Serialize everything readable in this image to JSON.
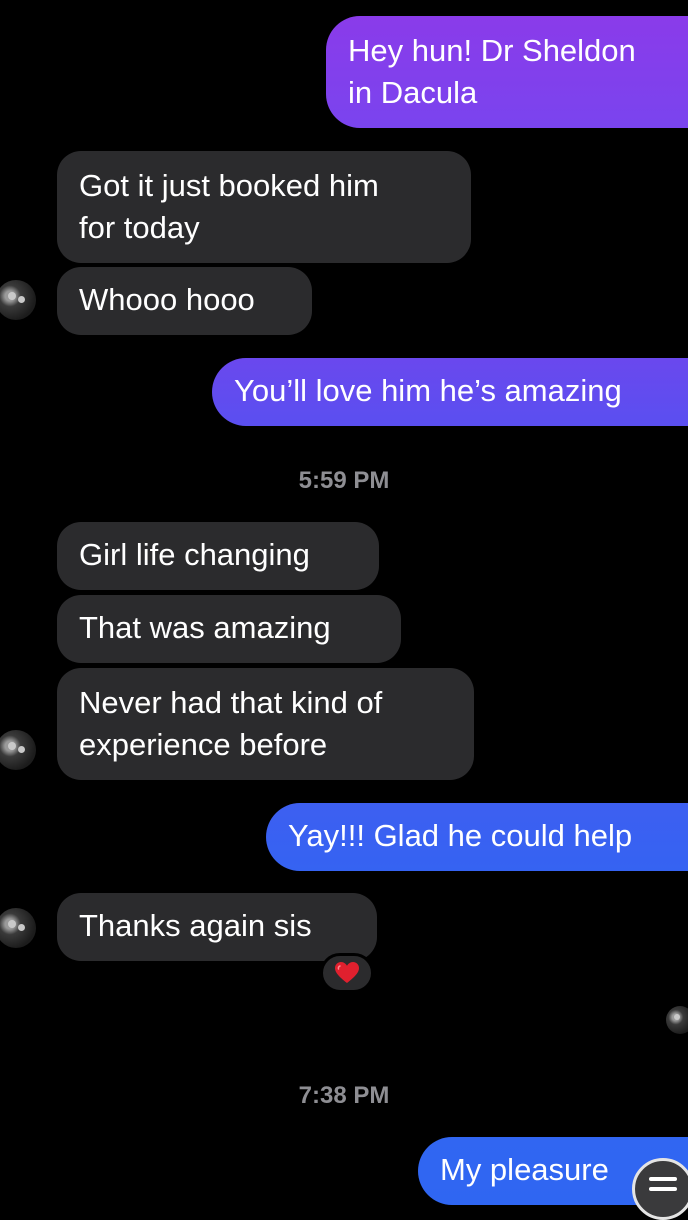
{
  "theme": {
    "background": "#000000",
    "incoming_bubble": "#2b2b2d",
    "outgoing_gradient_top": "#8a3bea",
    "outgoing_gradient_mid": "#5a4ff0",
    "outgoing_gradient_bottom": "#2f66f2",
    "timestamp_color": "#8e8e93"
  },
  "conversation": {
    "messages": [
      {
        "direction": "outgoing",
        "lines": [
          "Hey hun! Dr Sheldon",
          "in Dacula"
        ]
      },
      {
        "direction": "incoming",
        "lines": [
          "Got it just booked him",
          "for today"
        ]
      },
      {
        "direction": "incoming",
        "lines": [
          "Whooo hooo"
        ]
      },
      {
        "direction": "outgoing",
        "lines": [
          "You’ll love him he’s amazing"
        ]
      },
      {
        "direction": "incoming",
        "lines": [
          "Girl life changing"
        ]
      },
      {
        "direction": "incoming",
        "lines": [
          "That was amazing"
        ]
      },
      {
        "direction": "incoming",
        "lines": [
          "Never had that kind of",
          "experience before"
        ]
      },
      {
        "direction": "outgoing",
        "lines": [
          "Yay!!! Glad he could help"
        ]
      },
      {
        "direction": "incoming",
        "lines": [
          "Thanks again sis"
        ]
      },
      {
        "direction": "outgoing",
        "lines": [
          "My pleasure"
        ]
      }
    ],
    "timestamps": [
      "5:59 PM",
      "7:38 PM"
    ],
    "reaction": {
      "emoji": "heart-icon"
    }
  }
}
